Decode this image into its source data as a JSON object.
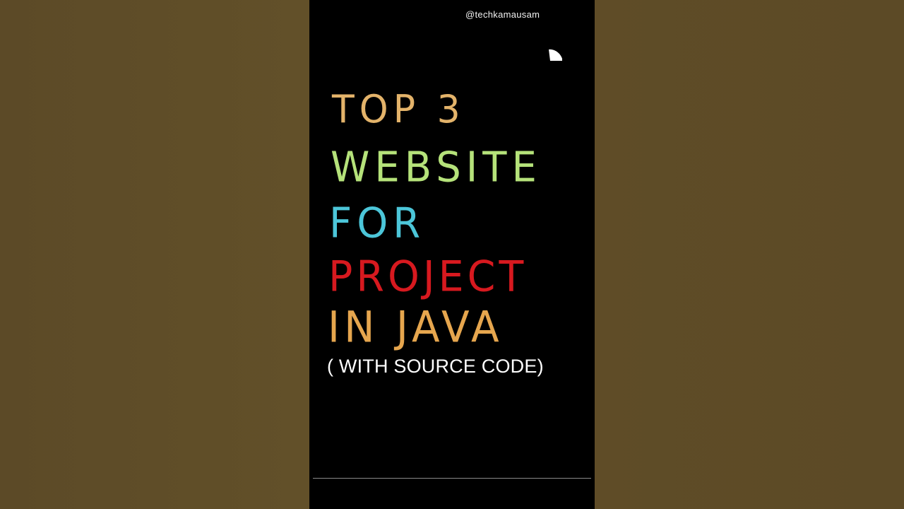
{
  "video": {
    "handle": "@techkamausam",
    "title_lines": [
      {
        "text": "TOP 3",
        "color": "#e3b36a"
      },
      {
        "text": "WEBSITE",
        "color": "#b5e27a"
      },
      {
        "text": "FOR",
        "color": "#4cc6d9"
      },
      {
        "text": "PROJECT",
        "color": "#d7191f"
      },
      {
        "text": "IN JAVA",
        "color": "#e6a64e"
      }
    ],
    "subtitle": "( WITH SOURCE CODE)",
    "subtitle_color": "#ffffff",
    "progress": 0
  },
  "colors": {
    "background": "#5e4b28",
    "panel": "#000000"
  }
}
